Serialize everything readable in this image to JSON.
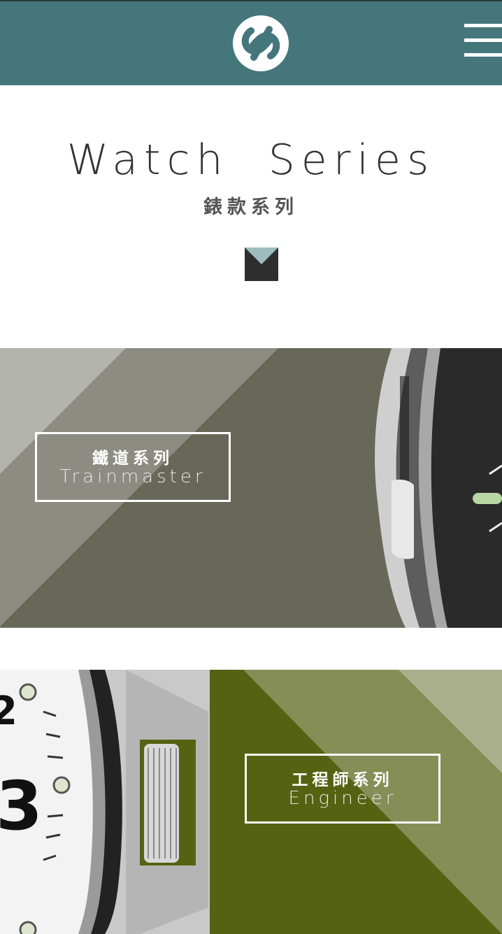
{
  "header": {
    "logo_icon": "brand-logo-icon",
    "menu_icon": "hamburger-menu-icon",
    "color": "#44767b"
  },
  "hero": {
    "title": "Watch  Series",
    "subtitle": "錶款系列",
    "scroll_icon": "chevron-down-icon"
  },
  "series": [
    {
      "name_zh": "鐵道系列",
      "name_en": "Trainmaster",
      "bg_color": "#686859"
    },
    {
      "name_zh": "工程師系列",
      "name_en": "Engineer",
      "bg_color": "#556211"
    }
  ]
}
